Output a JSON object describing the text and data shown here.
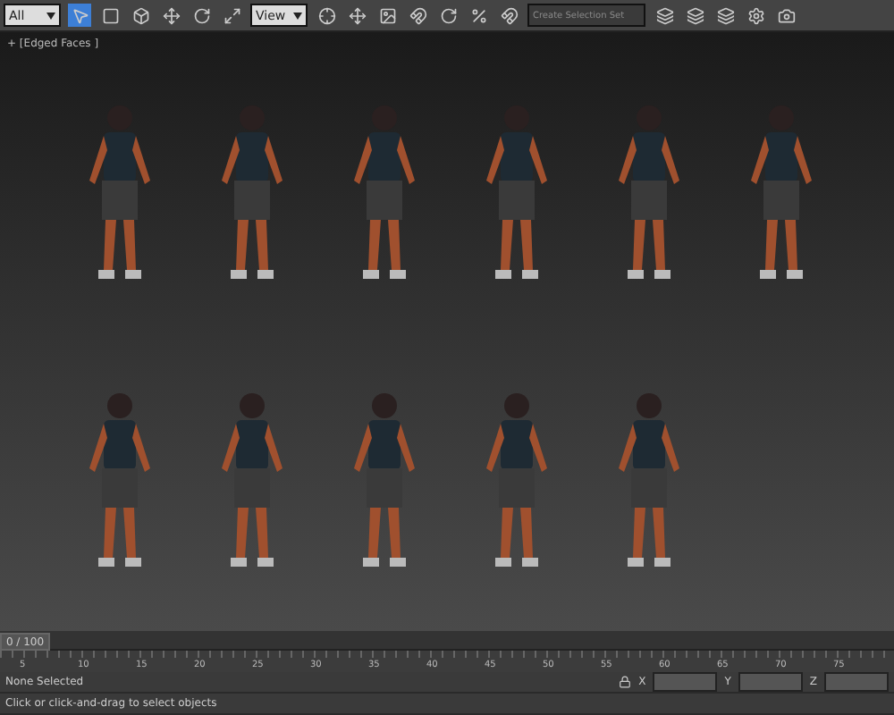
{
  "toolbar": {
    "filter_dropdown": {
      "value": "All"
    },
    "reference_dropdown": {
      "value": "View"
    },
    "selection_set_dropdown": {
      "placeholder": "Create Selection Set"
    }
  },
  "viewport": {
    "label": "+ [Edged Faces ]"
  },
  "time_slider": {
    "label": "0 / 100",
    "level": 0
  },
  "ruler": {
    "ticks": [
      "5",
      "10",
      "15",
      "20",
      "25",
      "30",
      "35",
      "40",
      "45",
      "50",
      "55",
      "60",
      "65",
      "70",
      "75"
    ]
  },
  "status": {
    "selection": "None Selected",
    "prompt": "Click or click-and-drag to select objects"
  },
  "coordinates": [
    {
      "axis": "X"
    },
    {
      "axis": "Y"
    },
    {
      "axis": "Z"
    }
  ]
}
